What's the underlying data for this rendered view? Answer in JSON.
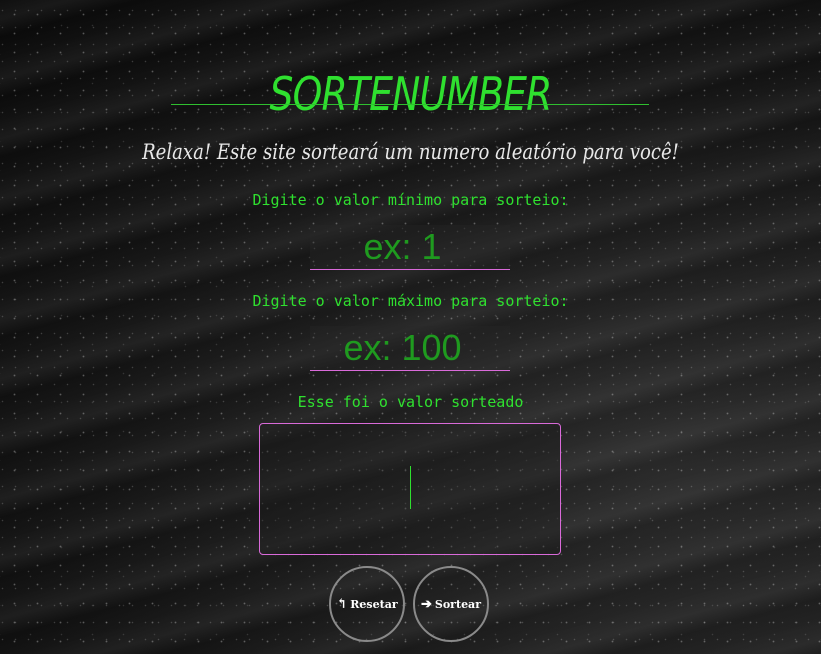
{
  "header": {
    "title": "SORTENUMBER",
    "subtitle": "Relaxa! Este site sorteará um numero aleatório para você!"
  },
  "form": {
    "min_label": "Digite o valor mínimo para sorteio:",
    "min_placeholder": "ex: 1",
    "max_label": "Digite o valor máximo para sorteio:",
    "max_placeholder": "ex: 100",
    "result_label": "Esse foi o valor sorteado"
  },
  "buttons": {
    "reset_icon": "↰",
    "reset_label": "Resetar",
    "draw_icon": "➔",
    "draw_label": "Sortear"
  },
  "icons": {
    "reset": "undo-arrow-icon",
    "draw": "right-arrow-icon"
  },
  "colors": {
    "accent_green": "#2fe02f",
    "input_border": "#d96ad9",
    "button_border": "#8a8a8a"
  }
}
